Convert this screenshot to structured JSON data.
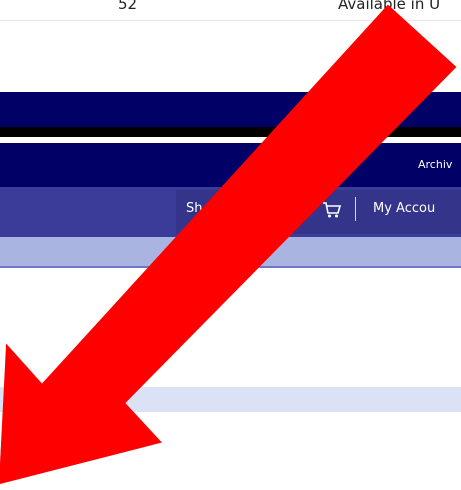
{
  "top_row": {
    "number": "52",
    "availability": "Available in U"
  },
  "header": {
    "archive_link": "Archiv"
  },
  "utility_nav": {
    "shop_label": "Sh",
    "my_account_label": "My Accou"
  },
  "icons": {
    "cart": "cart-icon",
    "annotation": "red-arrow-icon"
  },
  "colors": {
    "navy": "#000066",
    "nav_purple": "#3b3b9a",
    "subnav": "#aab4e0",
    "band": "#dbe2f5",
    "arrow": "#ff0000"
  }
}
